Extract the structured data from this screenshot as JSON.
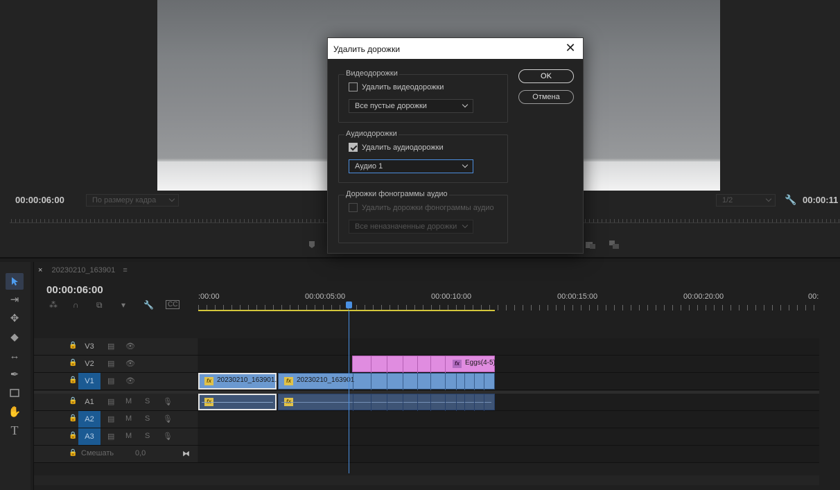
{
  "monitor": {
    "timecode_left": "00:00:06:00",
    "fit_label": "По размеру кадра",
    "resolution_label": "1/2",
    "timecode_right": "00:00:11"
  },
  "timeline": {
    "tab_label": "20230210_163901",
    "close_glyph": "×",
    "menu_glyph": "≡",
    "timecode": "00:00:06:00",
    "ruler_labels": [
      ":00:00",
      "00:00:05:00",
      "00:00:10:00",
      "00:00:15:00",
      "00:00:20:00",
      "00:"
    ],
    "tracks": {
      "v3": "V3",
      "v2": "V2",
      "v1": "V1",
      "a1": "A1",
      "a2": "A2",
      "a3": "A3",
      "m": "M",
      "s": "S",
      "mix_label": "Смешать",
      "mix_value": "0,0"
    },
    "clips": {
      "v1_first": "20230210_163901.",
      "v1_second": "20230210_163901",
      "v2_pink": "Eggs(4-5)",
      "fx": "fx"
    }
  },
  "dialog": {
    "title": "Удалить дорожки",
    "close_glyph": "✕",
    "video_group": {
      "title": "Видеодорожки",
      "checkbox_label": "Удалить видеодорожки",
      "checked": false,
      "select_value": "Все пустые дорожки"
    },
    "audio_group": {
      "title": "Аудиодорожки",
      "checkbox_label": "Удалить аудиодорожки",
      "checked": true,
      "select_value": "Аудио 1"
    },
    "submix_group": {
      "title": "Дорожки фонограммы аудио",
      "checkbox_label": "Удалить дорожки фонограммы аудио",
      "checked": false,
      "select_value": "Все неназначенные дорожки"
    },
    "ok_label": "OK",
    "cancel_label": "Отмена"
  },
  "colors": {
    "accent": "#4a90e2",
    "video_clip": "#6b99d0",
    "pink_clip": "#e08ce0",
    "audio_clip": "#3e5475",
    "work_area": "#d4c73b"
  }
}
